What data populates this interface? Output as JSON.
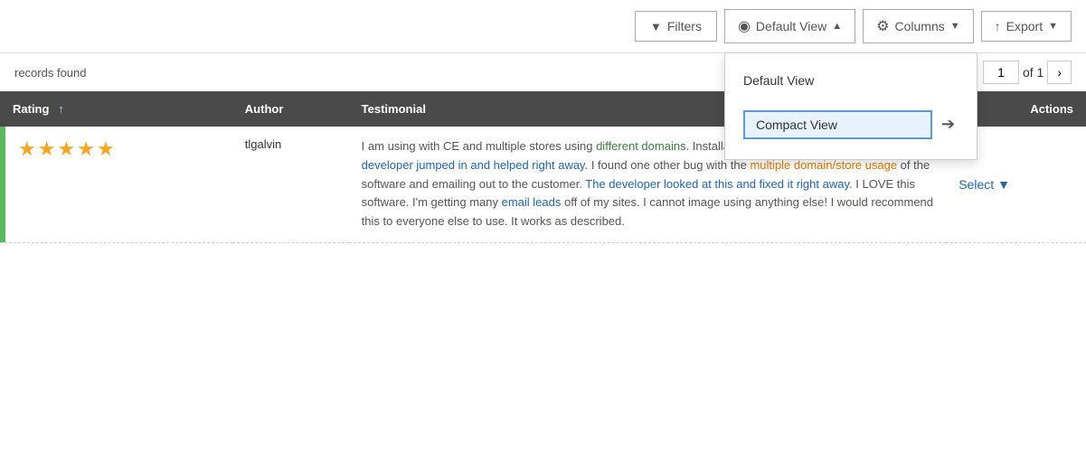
{
  "toolbar": {
    "filters_label": "Filters",
    "view_label": "Default View",
    "view_caret": "▲",
    "columns_label": "Columns",
    "export_label": "Export"
  },
  "view_dropdown": {
    "default_view_label": "Default View",
    "compact_view_label": "Compact View"
  },
  "subheader": {
    "records_found": "records found",
    "page_current": "1",
    "page_of": "of 1"
  },
  "table": {
    "columns": [
      {
        "key": "rating",
        "label": "Rating",
        "sortable": true
      },
      {
        "key": "author",
        "label": "Author"
      },
      {
        "key": "testimonial",
        "label": "Testimonial"
      },
      {
        "key": "actions",
        "label": "Actions"
      }
    ],
    "rows": [
      {
        "rating": 5,
        "author": "tlgalvin",
        "testimonial": "I am using with CE and multiple stores using different domains. Installation was a little tricky - but the developer jumped in and helped right away. I found one other bug with the multiple domain/store usage of the software and emailing out to the customer. The developer looked at this and fixed it right away. I LOVE this software. I'm getting many email leads off of my sites. I cannot image using anything else! I would recommend this to everyone else to use. It works as described.",
        "action": "Select"
      }
    ]
  },
  "icons": {
    "filter": "⬦",
    "eye": "👁",
    "gear": "⚙",
    "export": "⬆",
    "arrow_right": "➔",
    "sort_up": "↑",
    "chevron_down": "▼",
    "chevron_right": "›"
  }
}
